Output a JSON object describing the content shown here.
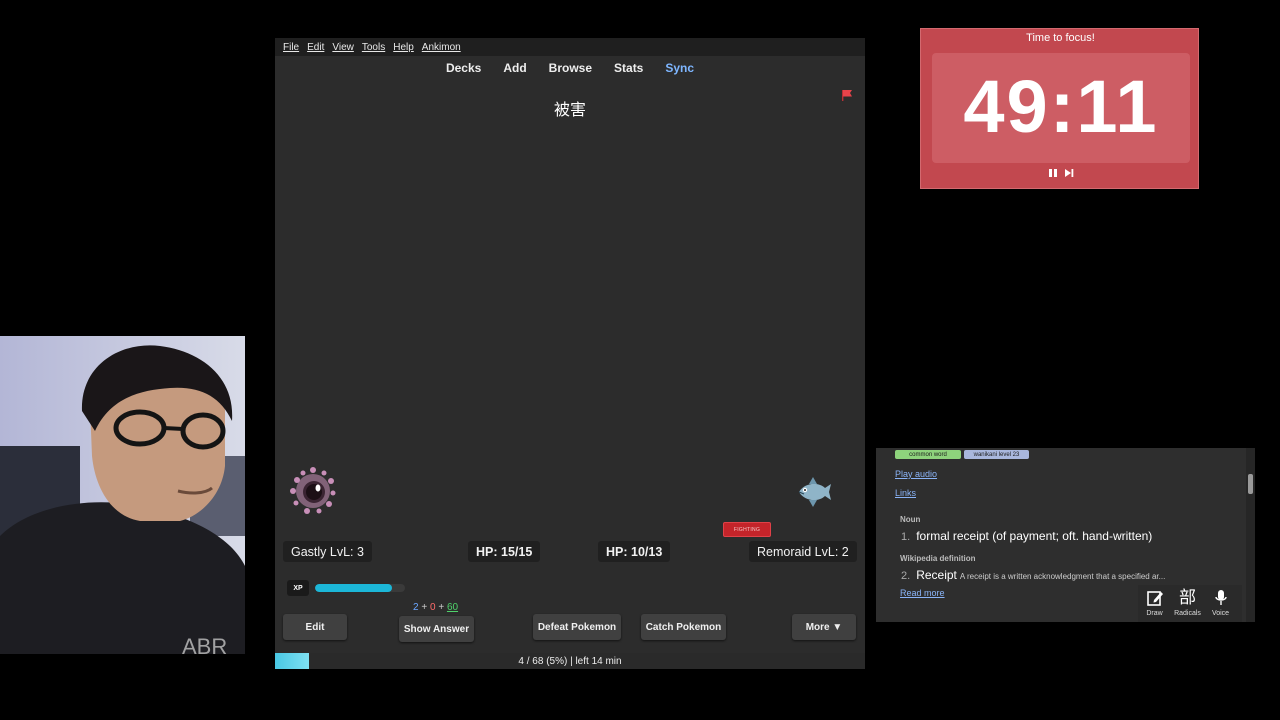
{
  "menu": [
    "File",
    "Edit",
    "View",
    "Tools",
    "Help",
    "Ankimon"
  ],
  "nav": {
    "decks": "Decks",
    "add": "Add",
    "browse": "Browse",
    "stats": "Stats",
    "sync": "Sync"
  },
  "card": {
    "front": "被害"
  },
  "battle": {
    "player": {
      "label": "Gastly LvL: 3",
      "hp": "HP: 15/15"
    },
    "enemy": {
      "label": "Remoraid LvL: 2",
      "hp": "HP: 10/13",
      "type_badge": "FIGHTING"
    },
    "xp_label": "XP",
    "xp_fraction": 0.85
  },
  "counts": {
    "new": "2",
    "plus1": "+",
    "learn": "0",
    "plus2": "+",
    "review": "60"
  },
  "buttons": {
    "edit": "Edit",
    "show_answer": "Show Answer",
    "defeat": "Defeat Pokemon",
    "catch": "Catch Pokemon",
    "more": "More ▼"
  },
  "progress": {
    "text": "4 / 68 (5%) | left 14 min",
    "fraction": 0.058
  },
  "timer": {
    "title": "Time to focus!",
    "time": "49:11"
  },
  "dictionary": {
    "tags": {
      "common": "common word",
      "wanikani": "wanikani level 23"
    },
    "play_audio": "Play audio",
    "links": "Links",
    "pos1": "Noun",
    "def1_num": "1.",
    "def1": "formal receipt (of payment; oft. hand-written)",
    "pos2": "Wikipedia definition",
    "def2_num": "2.",
    "def2": "Receipt",
    "def2_extra": "A receipt is a written acknowledgment that a specified ar...",
    "read_more": "Read more",
    "tools": {
      "draw": "Draw",
      "radicals_glyph": "部",
      "radicals": "Radicals",
      "voice": "Voice"
    }
  },
  "colors": {
    "timer_bg": "#c2484f",
    "xp_bar": "#1cb7d8",
    "sync": "#7eb6ff",
    "flag": "#e8434a"
  }
}
